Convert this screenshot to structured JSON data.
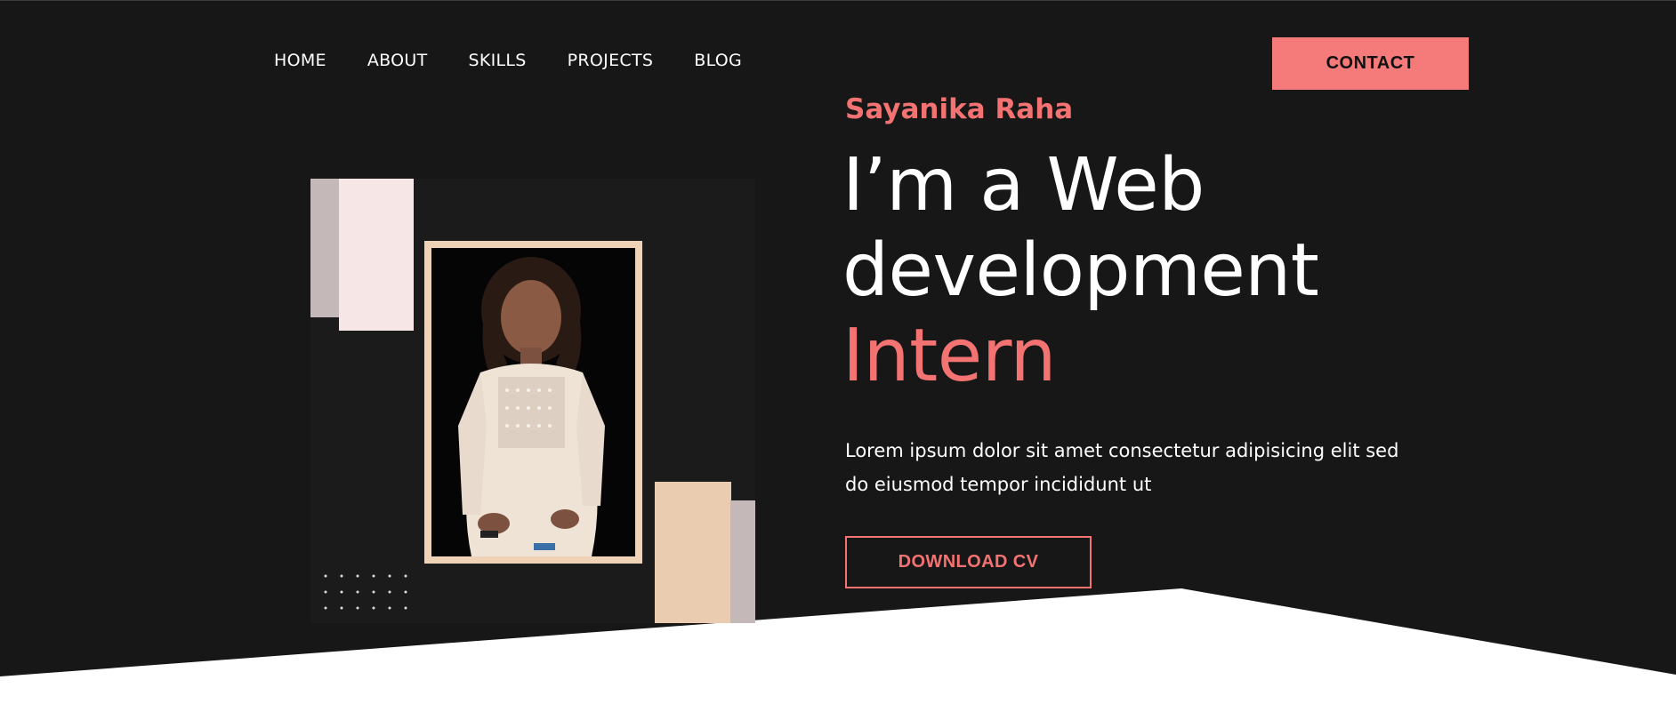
{
  "nav": {
    "items": [
      {
        "label": "HOME"
      },
      {
        "label": "ABOUT"
      },
      {
        "label": "SKILLS"
      },
      {
        "label": "PROJECTS"
      },
      {
        "label": "BLOG"
      }
    ],
    "contact_label": "CONTACT"
  },
  "hero": {
    "name": "Sayanika Raha",
    "headline_line1": "I’m a Web",
    "headline_line2": "development",
    "headline_accent": "Intern",
    "description": "Lorem ipsum dolor sit amet consectetur adipisicing elit sed do eiusmod tempor incididunt ut",
    "cv_label": "DOWNLOAD CV"
  },
  "colors": {
    "background": "#171717",
    "accent": "#f37272",
    "button_fill": "#f57a7a",
    "peach": "#eacdb0",
    "pink": "#f7e6e6",
    "gray": "#c4b9b8",
    "white": "#ffffff"
  }
}
